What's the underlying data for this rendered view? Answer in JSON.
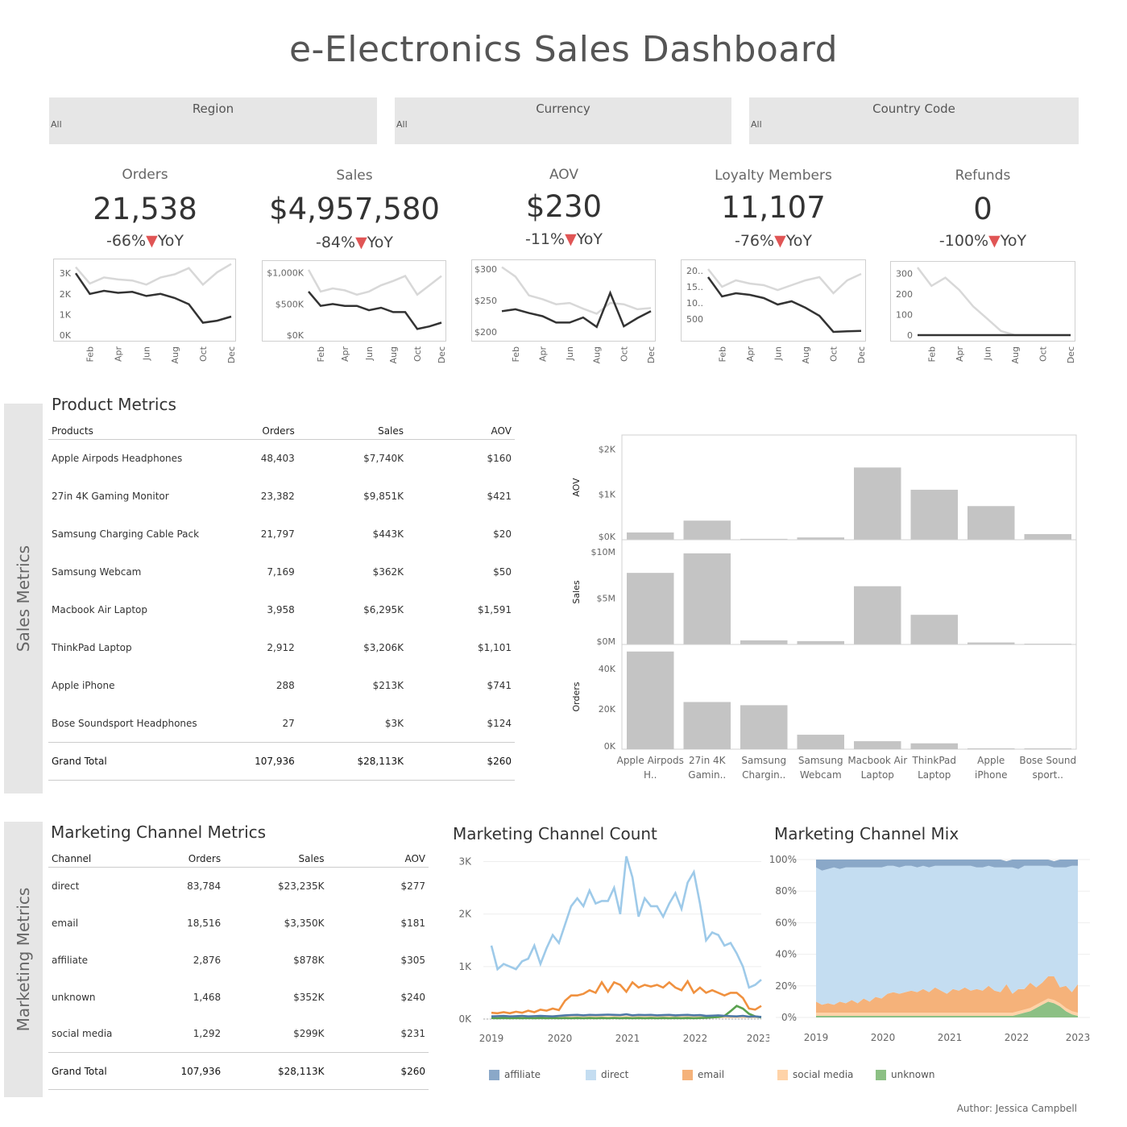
{
  "header": {
    "title": "e-Electronics Sales Dashboard"
  },
  "filters": [
    {
      "label": "Region",
      "value": "All"
    },
    {
      "label": "Currency",
      "value": "All"
    },
    {
      "label": "Country Code",
      "value": "All"
    }
  ],
  "kpis": [
    {
      "label": "Orders",
      "value": "21,538",
      "yoy_pct": "-66%",
      "yoy_suffix": "YoY",
      "yticks": [
        "3K",
        "2K",
        "1K",
        "0K"
      ],
      "ytick_vals": [
        3000,
        2000,
        1000,
        0
      ],
      "ymin": 0,
      "ymax": 3400,
      "current": [
        3000,
        2000,
        2150,
        2050,
        2100,
        1900,
        2000,
        1800,
        1500,
        600,
        700,
        900
      ],
      "prior": [
        3300,
        2500,
        2800,
        2700,
        2650,
        2450,
        2800,
        2950,
        3250,
        2450,
        3050,
        3450
      ]
    },
    {
      "label": "Sales",
      "value": "$4,957,580",
      "yoy_pct": "-84%",
      "yoy_suffix": "YoY",
      "yticks": [
        "$1,000K",
        "$500K",
        "$0K"
      ],
      "ytick_vals": [
        1000,
        500,
        0
      ],
      "ymin": 0,
      "ymax": 1100,
      "current": [
        700,
        470,
        500,
        470,
        470,
        400,
        440,
        370,
        370,
        100,
        140,
        200
      ],
      "prior": [
        1050,
        700,
        750,
        720,
        650,
        700,
        800,
        870,
        950,
        650,
        800,
        950
      ]
    },
    {
      "label": "AOV",
      "value": "$230",
      "yoy_pct": "-11%",
      "yoy_suffix": "YoY",
      "yticks": [
        "$300",
        "$250",
        "$200"
      ],
      "ytick_vals": [
        300,
        250,
        200
      ],
      "ymin": 195,
      "ymax": 305,
      "current": [
        233,
        236,
        230,
        225,
        215,
        215,
        223,
        208,
        262,
        209,
        222,
        233
      ],
      "prior": [
        303,
        288,
        258,
        252,
        244,
        246,
        237,
        229,
        246,
        244,
        236,
        238
      ]
    },
    {
      "label": "Loyalty Members",
      "value": "11,107",
      "yoy_pct": "-76%",
      "yoy_suffix": "YoY",
      "yticks": [
        "20..",
        "15..",
        "10..",
        "500"
      ],
      "ytick_vals": [
        2000,
        1500,
        1000,
        500
      ],
      "ymin": 0,
      "ymax": 2150,
      "current": [
        1800,
        1200,
        1300,
        1250,
        1150,
        950,
        1050,
        850,
        600,
        100,
        120,
        130
      ],
      "prior": [
        2050,
        1500,
        1700,
        1600,
        1550,
        1400,
        1550,
        1700,
        1800,
        1300,
        1700,
        1900
      ]
    },
    {
      "label": "Refunds",
      "value": "0",
      "yoy_pct": "-100%",
      "yoy_suffix": "YoY",
      "yticks": [
        "300",
        "200",
        "100",
        "0"
      ],
      "ytick_vals": [
        300,
        200,
        100,
        0
      ],
      "ymin": 0,
      "ymax": 330,
      "current": [
        0,
        0,
        0,
        0,
        0,
        0,
        0,
        0,
        0,
        0,
        0,
        0
      ],
      "prior": [
        330,
        240,
        280,
        220,
        140,
        80,
        20,
        0,
        0,
        0,
        0,
        0
      ]
    }
  ],
  "kpi_months": [
    "Feb",
    "Apr",
    "Jun",
    "Aug",
    "Oct",
    "Dec"
  ],
  "sales_metrics": {
    "sidebar_label": "Sales Metrics",
    "title": "Product Metrics",
    "columns": [
      "Products",
      "Orders",
      "Sales",
      "AOV"
    ],
    "rows": [
      [
        "Apple Airpods Headphones",
        "48,403",
        "$7,740K",
        "$160"
      ],
      [
        "27in 4K Gaming Monitor",
        "23,382",
        "$9,851K",
        "$421"
      ],
      [
        "Samsung Charging Cable Pack",
        "21,797",
        "$443K",
        "$20"
      ],
      [
        "Samsung Webcam",
        "7,169",
        "$362K",
        "$50"
      ],
      [
        "Macbook Air Laptop",
        "3,958",
        "$6,295K",
        "$1,591"
      ],
      [
        "ThinkPad Laptop",
        "2,912",
        "$3,206K",
        "$1,101"
      ],
      [
        "Apple iPhone",
        "288",
        "$213K",
        "$741"
      ],
      [
        "Bose Soundsport Headphones",
        "27",
        "$3K",
        "$124"
      ]
    ],
    "grand_total": [
      "Grand Total",
      "107,936",
      "$28,113K",
      "$260"
    ]
  },
  "chart_data": [
    {
      "type": "bar",
      "categories": [
        "Apple Airpods H..",
        "27in 4K Gamin..",
        "Samsung Chargin..",
        "Samsung Webcam",
        "Macbook Air Laptop",
        "ThinkPad Laptop",
        "Apple iPhone",
        "Bose Sound sport.."
      ],
      "series": [
        {
          "name": "AOV",
          "values": [
            160,
            421,
            20,
            50,
            1591,
            1101,
            741,
            124
          ],
          "ylim": [
            0,
            2200
          ],
          "yticks": [
            "$2K",
            "$1K",
            "$0K"
          ],
          "ytick_vals": [
            2000,
            1000,
            0
          ]
        },
        {
          "name": "Sales",
          "values": [
            7740,
            9851,
            443,
            362,
            6295,
            3206,
            213,
            3
          ],
          "ylim": [
            0,
            10800
          ],
          "yticks": [
            "$10M",
            "$5M",
            "$0M"
          ],
          "ytick_vals": [
            10000,
            5000,
            0
          ]
        },
        {
          "name": "Orders",
          "values": [
            48403,
            23382,
            21797,
            7169,
            3958,
            2912,
            288,
            27
          ],
          "ylim": [
            0,
            49500
          ],
          "yticks": [
            "40K",
            "20K",
            "0K"
          ],
          "ytick_vals": [
            40000,
            20000,
            0
          ]
        }
      ],
      "colors": {
        "bar": "#c4c4c4"
      }
    },
    {
      "type": "line",
      "title": "Marketing Channel Count",
      "x_ticks": [
        "2019",
        "2020",
        "2021",
        "2022",
        "2023"
      ],
      "ylim": [
        0,
        3100
      ],
      "yticks": [
        "3K",
        "2K",
        "1K",
        "0K"
      ],
      "ytick_vals": [
        3000,
        2000,
        1000,
        0
      ],
      "series": [
        {
          "name": "direct",
          "color": "#9ecae9",
          "values": [
            1400,
            950,
            1050,
            1000,
            950,
            1100,
            1150,
            1400,
            1050,
            1350,
            1600,
            1450,
            1800,
            2150,
            2300,
            2150,
            2450,
            2200,
            2250,
            2250,
            2500,
            2000,
            3100,
            2700,
            1950,
            2300,
            2150,
            2150,
            1950,
            2200,
            2400,
            2100,
            2600,
            2800,
            2200,
            1500,
            1650,
            1600,
            1400,
            1450,
            1250,
            1000,
            600,
            650,
            750
          ]
        },
        {
          "name": "email",
          "color": "#f0913f",
          "values": [
            120,
            110,
            130,
            110,
            140,
            120,
            160,
            130,
            180,
            160,
            200,
            170,
            350,
            450,
            450,
            480,
            550,
            500,
            700,
            520,
            700,
            650,
            520,
            700,
            600,
            650,
            620,
            650,
            600,
            700,
            600,
            550,
            720,
            500,
            600,
            500,
            550,
            500,
            450,
            500,
            500,
            400,
            200,
            180,
            250
          ]
        },
        {
          "name": "affiliate",
          "color": "#4e79a7",
          "values": [
            50,
            55,
            60,
            50,
            55,
            60,
            50,
            55,
            60,
            55,
            50,
            60,
            70,
            75,
            80,
            70,
            80,
            75,
            80,
            85,
            80,
            75,
            90,
            70,
            80,
            75,
            80,
            70,
            75,
            80,
            70,
            75,
            80,
            70,
            75,
            60,
            65,
            70,
            60,
            55,
            50,
            60,
            45,
            50,
            40
          ]
        },
        {
          "name": "unknown",
          "color": "#59a14f",
          "values": [
            20,
            15,
            20,
            15,
            20,
            15,
            20,
            15,
            20,
            15,
            20,
            15,
            20,
            15,
            20,
            15,
            20,
            15,
            20,
            15,
            20,
            15,
            20,
            15,
            20,
            15,
            20,
            15,
            20,
            15,
            20,
            15,
            20,
            15,
            20,
            25,
            30,
            40,
            60,
            150,
            250,
            200,
            100,
            50,
            30
          ]
        },
        {
          "name": "social media",
          "color": "#ffd6a5",
          "values": [
            40,
            35,
            40,
            35,
            40,
            35,
            40,
            35,
            40,
            35,
            40,
            35,
            40,
            35,
            40,
            35,
            40,
            35,
            40,
            35,
            40,
            35,
            40,
            35,
            40,
            35,
            40,
            35,
            40,
            35,
            40,
            35,
            40,
            35,
            40,
            35,
            40,
            35,
            40,
            35,
            40,
            35,
            40,
            35,
            40
          ]
        }
      ]
    },
    {
      "type": "area",
      "title": "Marketing Channel Mix",
      "x_ticks": [
        "2019",
        "2020",
        "2021",
        "2022",
        "2023"
      ],
      "ylim": [
        0,
        100
      ],
      "yticks": [
        "100%",
        "80%",
        "60%",
        "40%",
        "20%",
        "0%"
      ],
      "ytick_vals": [
        100,
        80,
        60,
        40,
        20,
        0
      ],
      "stack_order": [
        "unknown",
        "social media",
        "email",
        "direct",
        "affiliate"
      ],
      "series": [
        {
          "name": "unknown",
          "color": "#8cc084",
          "values": [
            1,
            1,
            1,
            1,
            1,
            1,
            1,
            1,
            1,
            1,
            1,
            1,
            1,
            1,
            1,
            1,
            1,
            1,
            1,
            1,
            1,
            1,
            1,
            1,
            1,
            1,
            1,
            1,
            1,
            1,
            1,
            1,
            1,
            1,
            2,
            3,
            4,
            6,
            8,
            10,
            9,
            7,
            4,
            2,
            1
          ]
        },
        {
          "name": "social media",
          "color": "#ffd3a8",
          "values": [
            2,
            2,
            2,
            2,
            2,
            2,
            2,
            2,
            2,
            2,
            2,
            2,
            2,
            2,
            2,
            2,
            2,
            2,
            2,
            2,
            2,
            2,
            2,
            2,
            2,
            2,
            2,
            2,
            2,
            2,
            2,
            2,
            2,
            2,
            2,
            2,
            2,
            2,
            2,
            2,
            2,
            2,
            2,
            2,
            2
          ]
        },
        {
          "name": "email",
          "color": "#f5b27a",
          "values": [
            7,
            5,
            6,
            5,
            7,
            6,
            8,
            6,
            9,
            7,
            10,
            9,
            12,
            13,
            12,
            13,
            14,
            13,
            15,
            13,
            16,
            14,
            12,
            15,
            14,
            16,
            14,
            15,
            14,
            17,
            14,
            13,
            18,
            12,
            14,
            13,
            16,
            11,
            12,
            14,
            15,
            10,
            14,
            12,
            18
          ]
        },
        {
          "name": "direct",
          "color": "#c4ddf1",
          "values": [
            85,
            85,
            85,
            87,
            84,
            86,
            84,
            86,
            83,
            85,
            82,
            83,
            81,
            80,
            80,
            80,
            79,
            79,
            78,
            79,
            77,
            79,
            81,
            78,
            79,
            77,
            79,
            77,
            78,
            76,
            78,
            79,
            74,
            80,
            76,
            78,
            74,
            77,
            74,
            70,
            69,
            76,
            75,
            80,
            75
          ]
        },
        {
          "name": "affiliate",
          "color": "#8aa8c8",
          "values": [
            5,
            7,
            6,
            5,
            6,
            5,
            5,
            5,
            5,
            5,
            5,
            5,
            4,
            4,
            5,
            4,
            4,
            5,
            4,
            5,
            4,
            4,
            4,
            4,
            4,
            4,
            4,
            5,
            5,
            4,
            5,
            5,
            4,
            5,
            6,
            4,
            4,
            4,
            4,
            4,
            4,
            5,
            5,
            4,
            4
          ]
        }
      ]
    }
  ],
  "marketing": {
    "sidebar_label": "Marketing Metrics",
    "title": "Marketing Channel Metrics",
    "columns": [
      "Channel",
      "Orders",
      "Sales",
      "AOV"
    ],
    "rows": [
      [
        "direct",
        "83,784",
        "$23,235K",
        "$277"
      ],
      [
        "email",
        "18,516",
        "$3,350K",
        "$181"
      ],
      [
        "affiliate",
        "2,876",
        "$878K",
        "$305"
      ],
      [
        "unknown",
        "1,468",
        "$352K",
        "$240"
      ],
      [
        "social media",
        "1,292",
        "$299K",
        "$231"
      ]
    ],
    "grand_total": [
      "Grand Total",
      "107,936",
      "$28,113K",
      "$260"
    ],
    "count_title": "Marketing Channel Count",
    "mix_title": "Marketing Channel Mix"
  },
  "legend": [
    {
      "name": "affiliate",
      "color": "#8aa8c8"
    },
    {
      "name": "direct",
      "color": "#c4ddf1"
    },
    {
      "name": "email",
      "color": "#f5b27a"
    },
    {
      "name": "social media",
      "color": "#ffd3a8"
    },
    {
      "name": "unknown",
      "color": "#8cc084"
    }
  ],
  "footer": {
    "author": "Author: Jessica Campbell"
  },
  "colors": {
    "kpi_current": "#333333",
    "kpi_prior": "#d8d8d8",
    "down_triangle": "#e05555",
    "panel_bg": "#e6e6e6"
  }
}
